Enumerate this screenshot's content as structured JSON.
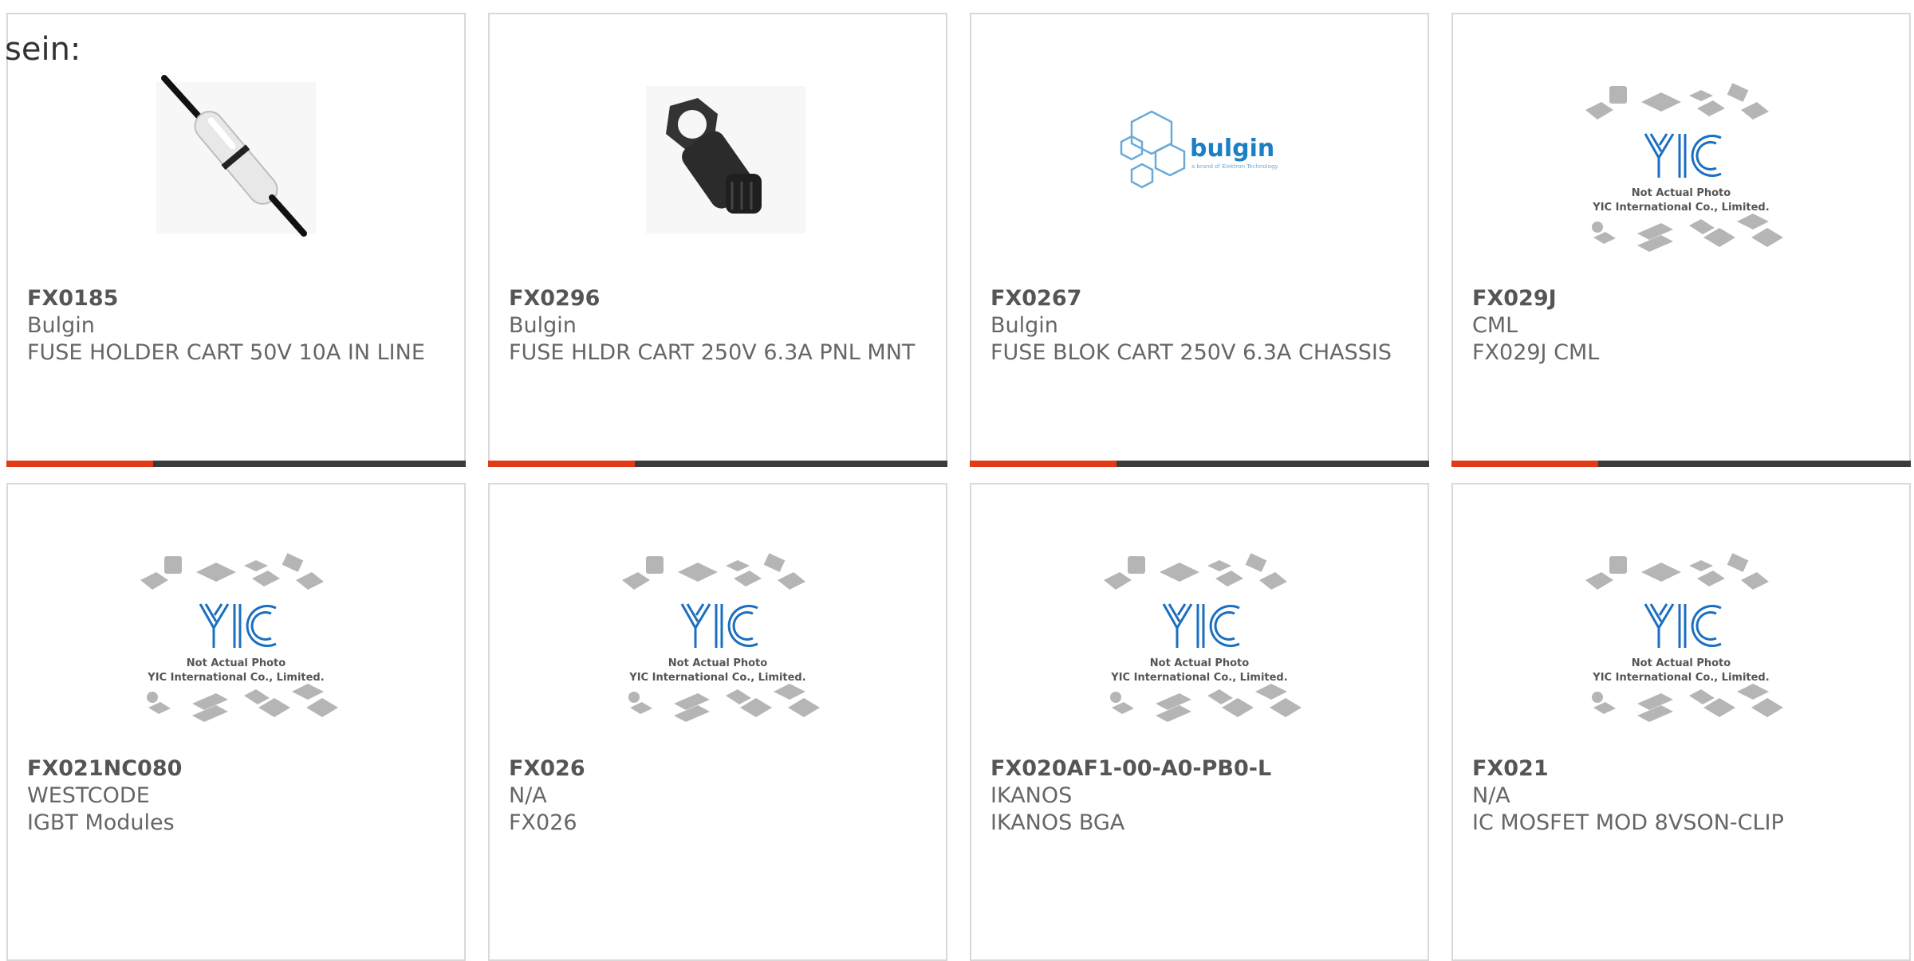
{
  "top_label": "sein:",
  "placeholder_image": {
    "logo_text": "YIC",
    "line1": "Not Actual Photo",
    "line2": "YIC International Co., Limited."
  },
  "bulgin_logo": {
    "brand": "bulgin",
    "tagline": "a brand of Elektron Technology"
  },
  "colors": {
    "accent": "#e03a16",
    "bar": "#3b3b3b",
    "border": "#d9d9d9",
    "text": "#666666"
  },
  "products": [
    {
      "part": "FX0185",
      "maker": "Bulgin",
      "desc": "FUSE HOLDER CART 50V 10A IN LINE",
      "image": "inline-fuse-holder"
    },
    {
      "part": "FX0296",
      "maker": "Bulgin",
      "desc": "FUSE HLDR CART 250V 6.3A PNL MNT",
      "image": "panel-fuse-holder"
    },
    {
      "part": "FX0267",
      "maker": "Bulgin",
      "desc": "FUSE BLOK CART 250V 6.3A CHASSIS",
      "image": "bulgin-logo"
    },
    {
      "part": "FX029J",
      "maker": "CML",
      "desc": "FX029J CML",
      "image": "placeholder"
    },
    {
      "part": "FX021NC080",
      "maker": "WESTCODE",
      "desc": "IGBT Modules",
      "image": "placeholder"
    },
    {
      "part": "FX026",
      "maker": "N/A",
      "desc": "FX026",
      "image": "placeholder"
    },
    {
      "part": "FX020AF1-00-A0-PB0-L",
      "maker": "IKANOS",
      "desc": "IKANOS BGA",
      "image": "placeholder"
    },
    {
      "part": "FX021",
      "maker": "N/A",
      "desc": "IC MOSFET MOD 8VSON-CLIP",
      "image": "placeholder"
    }
  ]
}
